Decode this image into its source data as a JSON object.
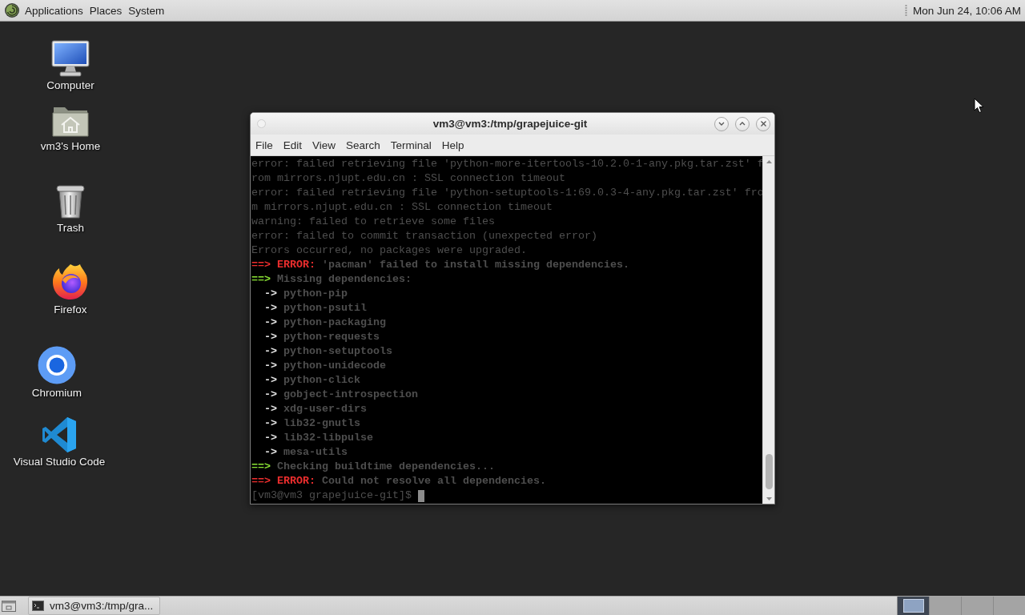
{
  "top_panel": {
    "menus": [
      {
        "label": "Applications"
      },
      {
        "label": "Places"
      },
      {
        "label": "System"
      }
    ],
    "clock": "Mon Jun 24, 10:06 AM"
  },
  "desktop_icons": [
    {
      "label": "Computer",
      "kind": "computer"
    },
    {
      "label": "vm3's Home",
      "kind": "home"
    },
    {
      "label": "Trash",
      "kind": "trash"
    },
    {
      "label": "Firefox",
      "kind": "firefox"
    },
    {
      "label": "Chromium",
      "kind": "chromium"
    },
    {
      "label": "Visual Studio Code",
      "kind": "vscode"
    }
  ],
  "terminal_window": {
    "title": "vm3@vm3:/tmp/grapejuice-git",
    "menus": [
      "File",
      "Edit",
      "View",
      "Search",
      "Terminal",
      "Help"
    ],
    "lines": [
      {
        "kind": "plain",
        "text": "error: failed retrieving file 'python-more-itertools-10.2.0-1-any.pkg.tar.zst' f"
      },
      {
        "kind": "plain",
        "text": "rom mirrors.njupt.edu.cn : SSL connection timeout"
      },
      {
        "kind": "plain",
        "text": "error: failed retrieving file 'python-setuptools-1:69.0.3-4-any.pkg.tar.zst' fro"
      },
      {
        "kind": "plain",
        "text": "m mirrors.njupt.edu.cn : SSL connection timeout"
      },
      {
        "kind": "plain",
        "text": "warning: failed to retrieve some files"
      },
      {
        "kind": "plain",
        "text": "error: failed to commit transaction (unexpected error)"
      },
      {
        "kind": "plain",
        "text": "Errors occurred, no packages were upgraded."
      },
      {
        "kind": "error",
        "marker": "==>",
        "label": "ERROR:",
        "text": "'pacman' failed to install missing dependencies."
      },
      {
        "kind": "info",
        "marker": "==>",
        "text": "Missing dependencies:"
      },
      {
        "kind": "item",
        "marker": "->",
        "text": "python-pip"
      },
      {
        "kind": "item",
        "marker": "->",
        "text": "python-psutil"
      },
      {
        "kind": "item",
        "marker": "->",
        "text": "python-packaging"
      },
      {
        "kind": "item",
        "marker": "->",
        "text": "python-requests"
      },
      {
        "kind": "item",
        "marker": "->",
        "text": "python-setuptools"
      },
      {
        "kind": "item",
        "marker": "->",
        "text": "python-unidecode"
      },
      {
        "kind": "item",
        "marker": "->",
        "text": "python-click"
      },
      {
        "kind": "item",
        "marker": "->",
        "text": "gobject-introspection"
      },
      {
        "kind": "item",
        "marker": "->",
        "text": "xdg-user-dirs"
      },
      {
        "kind": "item",
        "marker": "->",
        "text": "lib32-gnutls"
      },
      {
        "kind": "item",
        "marker": "->",
        "text": "lib32-libpulse"
      },
      {
        "kind": "item",
        "marker": "->",
        "text": "mesa-utils"
      },
      {
        "kind": "info",
        "marker": "==>",
        "text": "Checking buildtime dependencies..."
      },
      {
        "kind": "error",
        "marker": "==>",
        "label": "ERROR:",
        "text": "Could not resolve all dependencies."
      },
      {
        "kind": "prompt",
        "text": "[vm3@vm3 grapejuice-git]$"
      }
    ]
  },
  "bottom_panel": {
    "tasks": [
      {
        "label": "vm3@vm3:/tmp/gra..."
      }
    ],
    "workspaces": [
      {
        "selected": true
      },
      {
        "selected": false
      },
      {
        "selected": false
      },
      {
        "selected": false
      }
    ]
  }
}
